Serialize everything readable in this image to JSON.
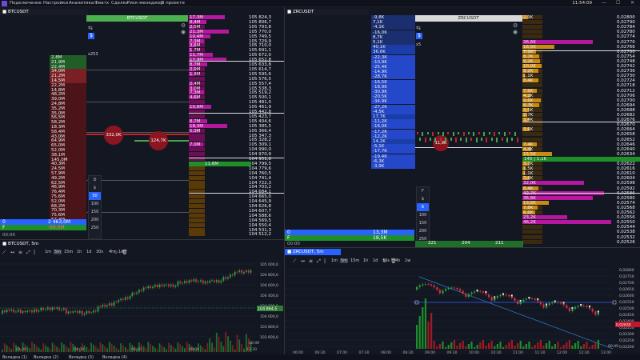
{
  "menu": {
    "items": [
      "Подключение",
      "Настройки",
      "Аналитика",
      "Фиатх",
      "Сделки",
      "Риск-менеджер",
      "О проекте"
    ],
    "clock": "11:54:09"
  },
  "left": {
    "label": "BTCUSDT",
    "header": "BTCUSDT",
    "x253": "x253",
    "b_label": "B",
    "f_label": "F",
    "vol_col": [
      "2,8M",
      "21,9M",
      "22,4M",
      "34,0M",
      "21,2M",
      "14,5M",
      "22,2M",
      "14,8M",
      "48,2M",
      "39,0M",
      "24,8M",
      "35,2M",
      "35,0M",
      "56,5M",
      "58,2M",
      "18,3M",
      "58,4M",
      "43,0M",
      "64,9M",
      "65,0M",
      "52,0M",
      "38,1M",
      "145,0M",
      "40,3M",
      "24,5M",
      "57,9M",
      "49,2M",
      "62,5M",
      "46,9M",
      "76,4M",
      "75,6M",
      "52,0M",
      "68,2M",
      "70,3M",
      "75,6M",
      "57,4M",
      "60,0M"
    ],
    "ladder_vol": [
      "17,3M",
      "8,4M",
      "2,5M",
      "21,3M",
      "10,4M",
      "7,3M",
      "3,6M",
      "1,7M",
      "11,7M",
      "17,9M",
      "8,7M",
      "2,9M",
      "1,8M",
      "",
      "2,4M",
      "3,0M",
      "7,3M",
      "4,6M",
      "",
      "10,6M",
      "",
      "",
      "8,7M",
      "18,3M",
      "5,3M",
      "",
      "",
      "7,0M",
      "",
      "",
      "",
      "1,3M",
      "",
      "",
      "",
      "",
      "",
      "",
      "",
      "",
      "",
      "",
      "",
      "",
      "",
      "",
      ""
    ],
    "ladder_col2": [
      "",
      "",
      "",
      "",
      "",
      "",
      "",
      "",
      "",
      "",
      "",
      "",
      "",
      "",
      "",
      "",
      "",
      "",
      "",
      "",
      "",
      "",
      "",
      "",
      "",
      "",
      "",
      "",
      "",
      "",
      "",
      "11,6M"
    ],
    "prices": [
      "105 824,3",
      "105 806,7",
      "105 793,8",
      "105 770,0",
      "105 749,5",
      "105 729,9",
      "105 710,0",
      "105 691,1",
      "105 672,0",
      "105 652,8",
      "105 633,8",
      "105 614,7",
      "105 595,6",
      "105 576,5",
      "105 557,4",
      "105 538,3",
      "105 519,2",
      "105 500,1",
      "105 481,0",
      "105 461,9",
      "105 442,8",
      "105 423,7",
      "105 404,6",
      "105 385,5",
      "105 366,4",
      "105 347,3",
      "105 328,2",
      "105 309,1",
      "104 990,0",
      "104 970,9",
      "104 951,8",
      "104 799,5",
      "104 779,6",
      "104 760,5",
      "104 741,4",
      "104 722,3",
      "104 703,2",
      "104 684,1",
      "104 665,0",
      "104 645,9",
      "104 626,8",
      "104 607,7",
      "104 588,6",
      "104 569,5",
      "104 550,4",
      "104 531,3",
      "104 512,2"
    ],
    "bubbles": [
      "332,0K",
      "124,7K"
    ],
    "status_blue_label": "0",
    "status_blue_val": "2 463,0M",
    "status_green_label": "F",
    "status_green_val": "-69,6M",
    "mini_opts": [
      "D",
      "$",
      "50",
      "100",
      "150",
      "200",
      "250"
    ],
    "foot_time": "00:00",
    "chart": {
      "title": "BTCUSDT, 5m",
      "tfs": [
        "1m",
        "5m",
        "15m",
        "1h",
        "1d",
        "30s",
        "4h",
        "1w"
      ],
      "yticks": [
        "105 000,0",
        "104 800,0",
        "104 600,0",
        "104 400,0",
        "104 200,0",
        "104 000,0",
        "103 800,0",
        "103 600,0"
      ],
      "last_price": "104 864,5",
      "xticks": [
        "01:30",
        "04:00",
        "06:30",
        "09:00",
        "11:30"
      ],
      "corner": "00:49"
    }
  },
  "right": {
    "label": "ZRCUSDT",
    "header": "ZRCUSDT",
    "x5": "x5",
    "b_label": "B",
    "f_label": "F",
    "left_col": [
      "-9,8K",
      "7,1K",
      "-4,1K",
      "-16,0K",
      "8,7K",
      "5,1K",
      "40,1K",
      "36,6K",
      "-22,3K",
      "-10,9K",
      "-25,4K",
      "-14,9K",
      "-28,7K",
      "-16,5K",
      "-18,9K",
      "-30,9K",
      "-20,5K",
      "-34,9K",
      "-27,2K",
      "-4,5K",
      "17,7K",
      "-11,2K",
      "-16,0K",
      "-17,2K",
      "-12,2K",
      "14,2K",
      "-5,1K",
      "-17,7K",
      "-19,4K",
      "-6,3K",
      "-3,9K"
    ],
    "bubble": "11,9K",
    "ladder_vol": [
      "2,9K",
      "",
      "",
      "",
      "",
      "36,6K",
      "16,5K",
      "7,1K",
      "8,7K",
      "9,2K",
      "10,0K",
      "8,2K",
      "1,1K",
      "8,4K",
      "",
      "7,6K",
      "4,2K",
      "9,6K",
      "8,7K",
      "3,5K",
      "2,7K",
      "3,4K",
      "",
      "3,6K",
      "",
      "145",
      "7,4K",
      "4,4K",
      "15,5K",
      "16,7K",
      "3,7K",
      "1,5K",
      "1,1K",
      "3,6K",
      "32,0K",
      "8,4K",
      "42,7K",
      "36,8K",
      "13,6K",
      "7,8K",
      "6,6K",
      "23,2K",
      "46,2K"
    ],
    "prices": [
      "0,02800",
      "0,02790",
      "0,02784",
      "0,02780",
      "0,02774",
      "0,02770",
      "0,02766",
      "0,02760",
      "0,02754",
      "0,02748",
      "0,02742",
      "0,02736",
      "0,02730",
      "0,02724",
      "0,02718",
      "0,02712",
      "0,02706",
      "0,02700",
      "0,02694",
      "0,02688",
      "0,02682",
      "0,02676",
      "0,02670",
      "0,02664",
      "0,02658",
      "0,02652",
      "0,02646",
      "0,02640",
      "0,02634",
      "0,02628",
      "0,02622",
      "0,02616",
      "0,02610",
      "0,02604",
      "0,02598",
      "0,02592",
      "0,02586",
      "0,02580",
      "0,02574",
      "0,02568",
      "0,02562",
      "0,02556",
      "0,02550",
      "0,02544",
      "0,02538",
      "0,02532",
      "0,02526"
    ],
    "mid_row": "145 | 1,1K",
    "status_blue_label": "0",
    "status_blue_val": "13,3M",
    "status_green_label": "F",
    "status_green_val": "18,5K",
    "mini_opts": [
      "F",
      "$",
      "6",
      "100",
      "150",
      "200",
      "250"
    ],
    "foot_time": "00:00",
    "foot_ticks": [
      "221",
      "204",
      "211"
    ],
    "chart": {
      "title": "ZRCUSDT, 5m",
      "tfs": [
        "1m",
        "5m",
        "15m",
        "1h",
        "1d",
        "30s",
        "4h",
        "1w"
      ],
      "yticks": [
        "0,02800",
        "0,02750",
        "0,02700",
        "0,02650",
        "0,02600",
        "0,02550",
        "0,02500",
        "0,02450",
        "0,02400",
        "0,02350",
        "0,02300",
        "0,02250",
        "0,02200"
      ],
      "last_price": "0,02630",
      "xticks": [
        "06:00",
        "06:30",
        "07:00",
        "07:30",
        "08:00",
        "08:30",
        "09:00",
        "09:30",
        "10:00",
        "10:30",
        "11:00",
        "11:30",
        "12:00",
        "12:30",
        "13:00"
      ],
      "corner": "00:49"
    }
  },
  "tabs": [
    "Вкладка (1)",
    "Вкладка (2)",
    "Вкладка (3)",
    "Вкладка (4)"
  ],
  "colors": {
    "bg": "#131722",
    "ask": "#b5179e",
    "bid": "#c98a12",
    "green": "#1f8f2a",
    "blue": "#2962ff",
    "red": "#c0172b"
  }
}
